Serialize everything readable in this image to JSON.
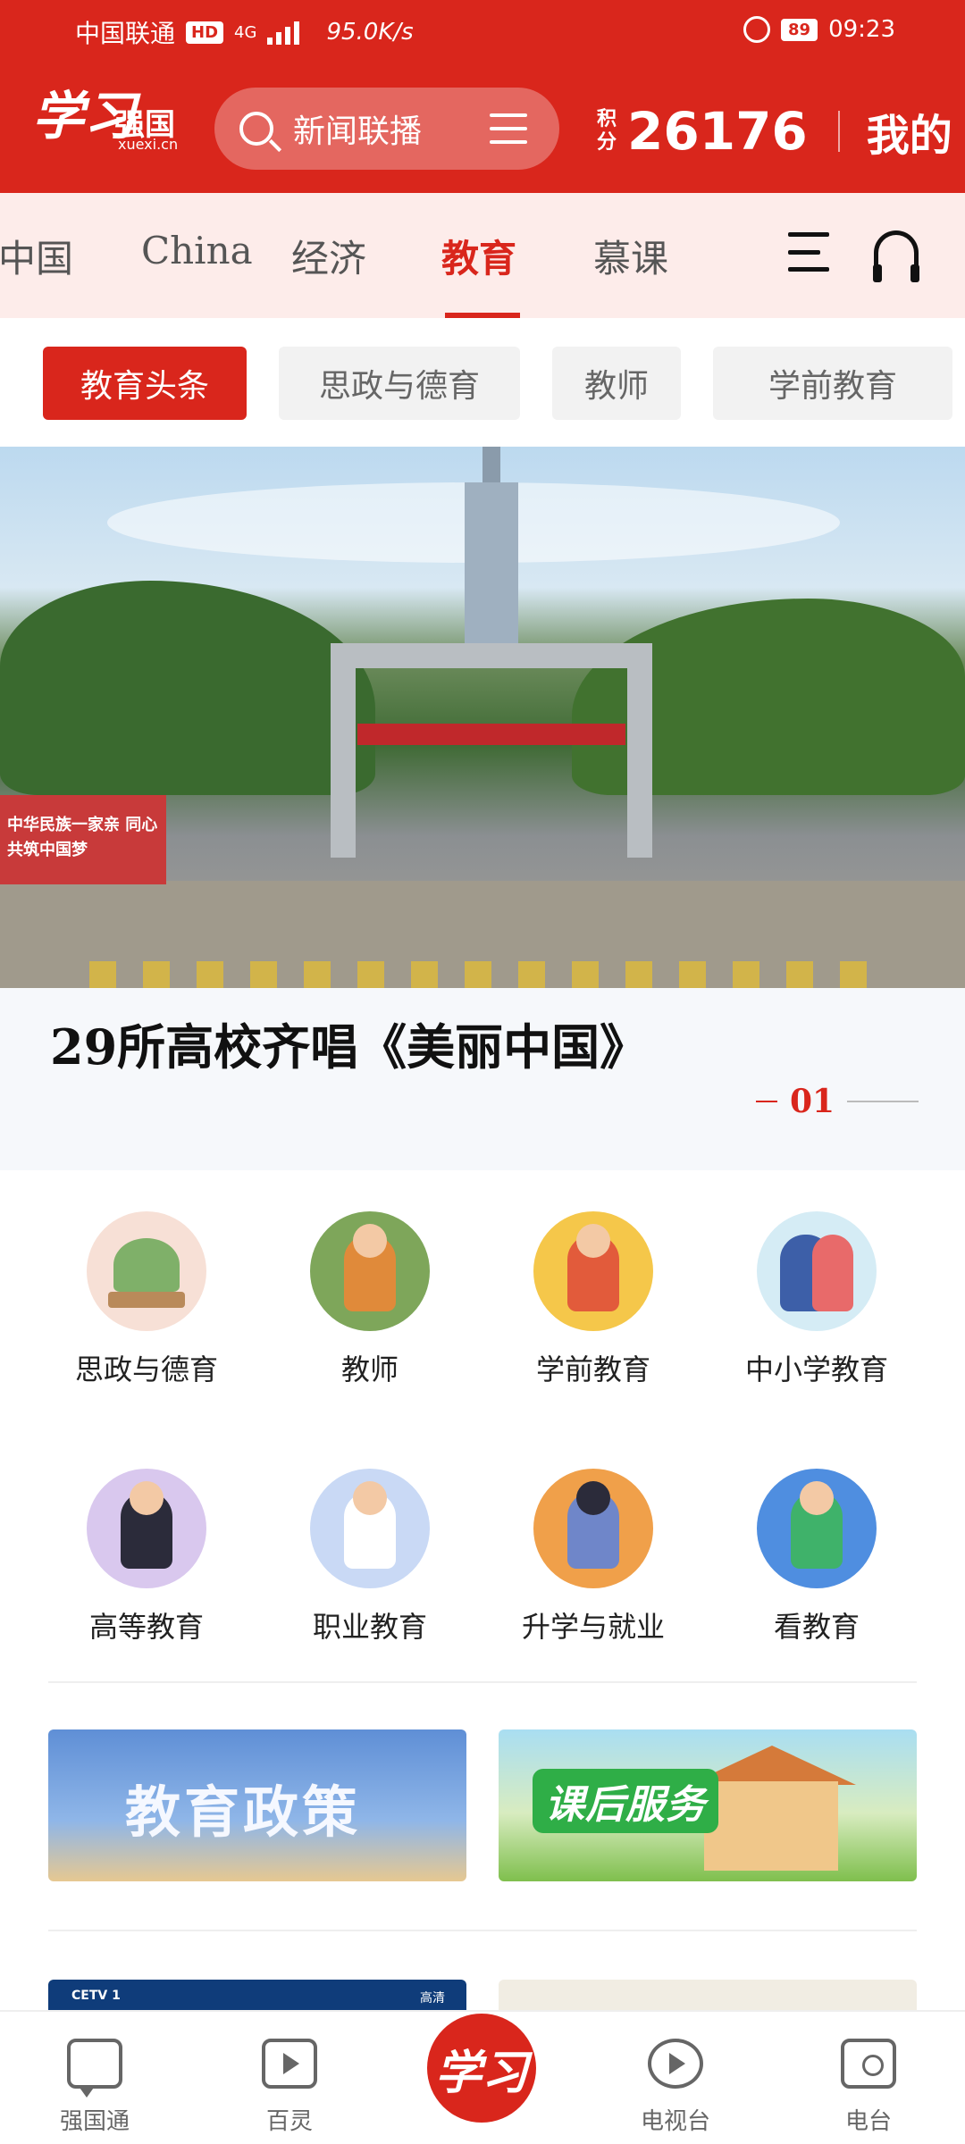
{
  "status_bar": {
    "carrier": "中国联通",
    "hd": "HD",
    "signal": "4G",
    "speed": "95.0K/s",
    "battery": "89",
    "time": "09:23"
  },
  "header": {
    "logo_main": "学习",
    "logo_sub_cn": "强国",
    "logo_sub_en": "xuexi.cn",
    "search_placeholder": "新闻联播",
    "points_label": "积分",
    "points_value": "26176",
    "mine_label": "我的",
    "brand_color": "#d9261c"
  },
  "tabs": [
    {
      "label": "中国",
      "active": false
    },
    {
      "label": "China",
      "active": false
    },
    {
      "label": "经济",
      "active": false
    },
    {
      "label": "教育",
      "active": true
    },
    {
      "label": "慕课",
      "active": false
    }
  ],
  "chips": [
    {
      "label": "教育头条",
      "active": true
    },
    {
      "label": "思政与德育",
      "active": false
    },
    {
      "label": "教师",
      "active": false
    },
    {
      "label": "学前教育",
      "active": false
    }
  ],
  "banner": {
    "headline": "29所高校齐唱《美丽中国》",
    "page_number": "01",
    "sign_text": "中华民族一家亲 同心共筑中国梦"
  },
  "grid": [
    {
      "label": "思政与德育",
      "icon": "book-flowers-icon",
      "color": "#f7e0d6"
    },
    {
      "label": "教师",
      "icon": "teacher-icon",
      "color": "#7ea65a"
    },
    {
      "label": "学前教育",
      "icon": "child-icon",
      "color": "#f5c74a"
    },
    {
      "label": "中小学教育",
      "icon": "students-icon",
      "color": "#d5ecf5"
    },
    {
      "label": "高等教育",
      "icon": "graduate-icon",
      "color": "#d9c8ee"
    },
    {
      "label": "职业教育",
      "icon": "worker-icon",
      "color": "#c9d9f5"
    },
    {
      "label": "升学与就业",
      "icon": "career-icon",
      "color": "#f0a04a"
    },
    {
      "label": "看教育",
      "icon": "kid-ball-icon",
      "color": "#4f8ee0"
    }
  ],
  "promos": {
    "policy": "教育政策",
    "after_school": "课后服务"
  },
  "peek": {
    "cetv": "CETV 1",
    "hd_label": "高清"
  },
  "nav": [
    {
      "label": "强国通",
      "icon": "chat-icon"
    },
    {
      "label": "百灵",
      "icon": "video-icon"
    },
    {
      "label": "学习",
      "icon": "xuexi-logo-icon"
    },
    {
      "label": "电视台",
      "icon": "play-icon"
    },
    {
      "label": "电台",
      "icon": "radio-icon"
    }
  ]
}
